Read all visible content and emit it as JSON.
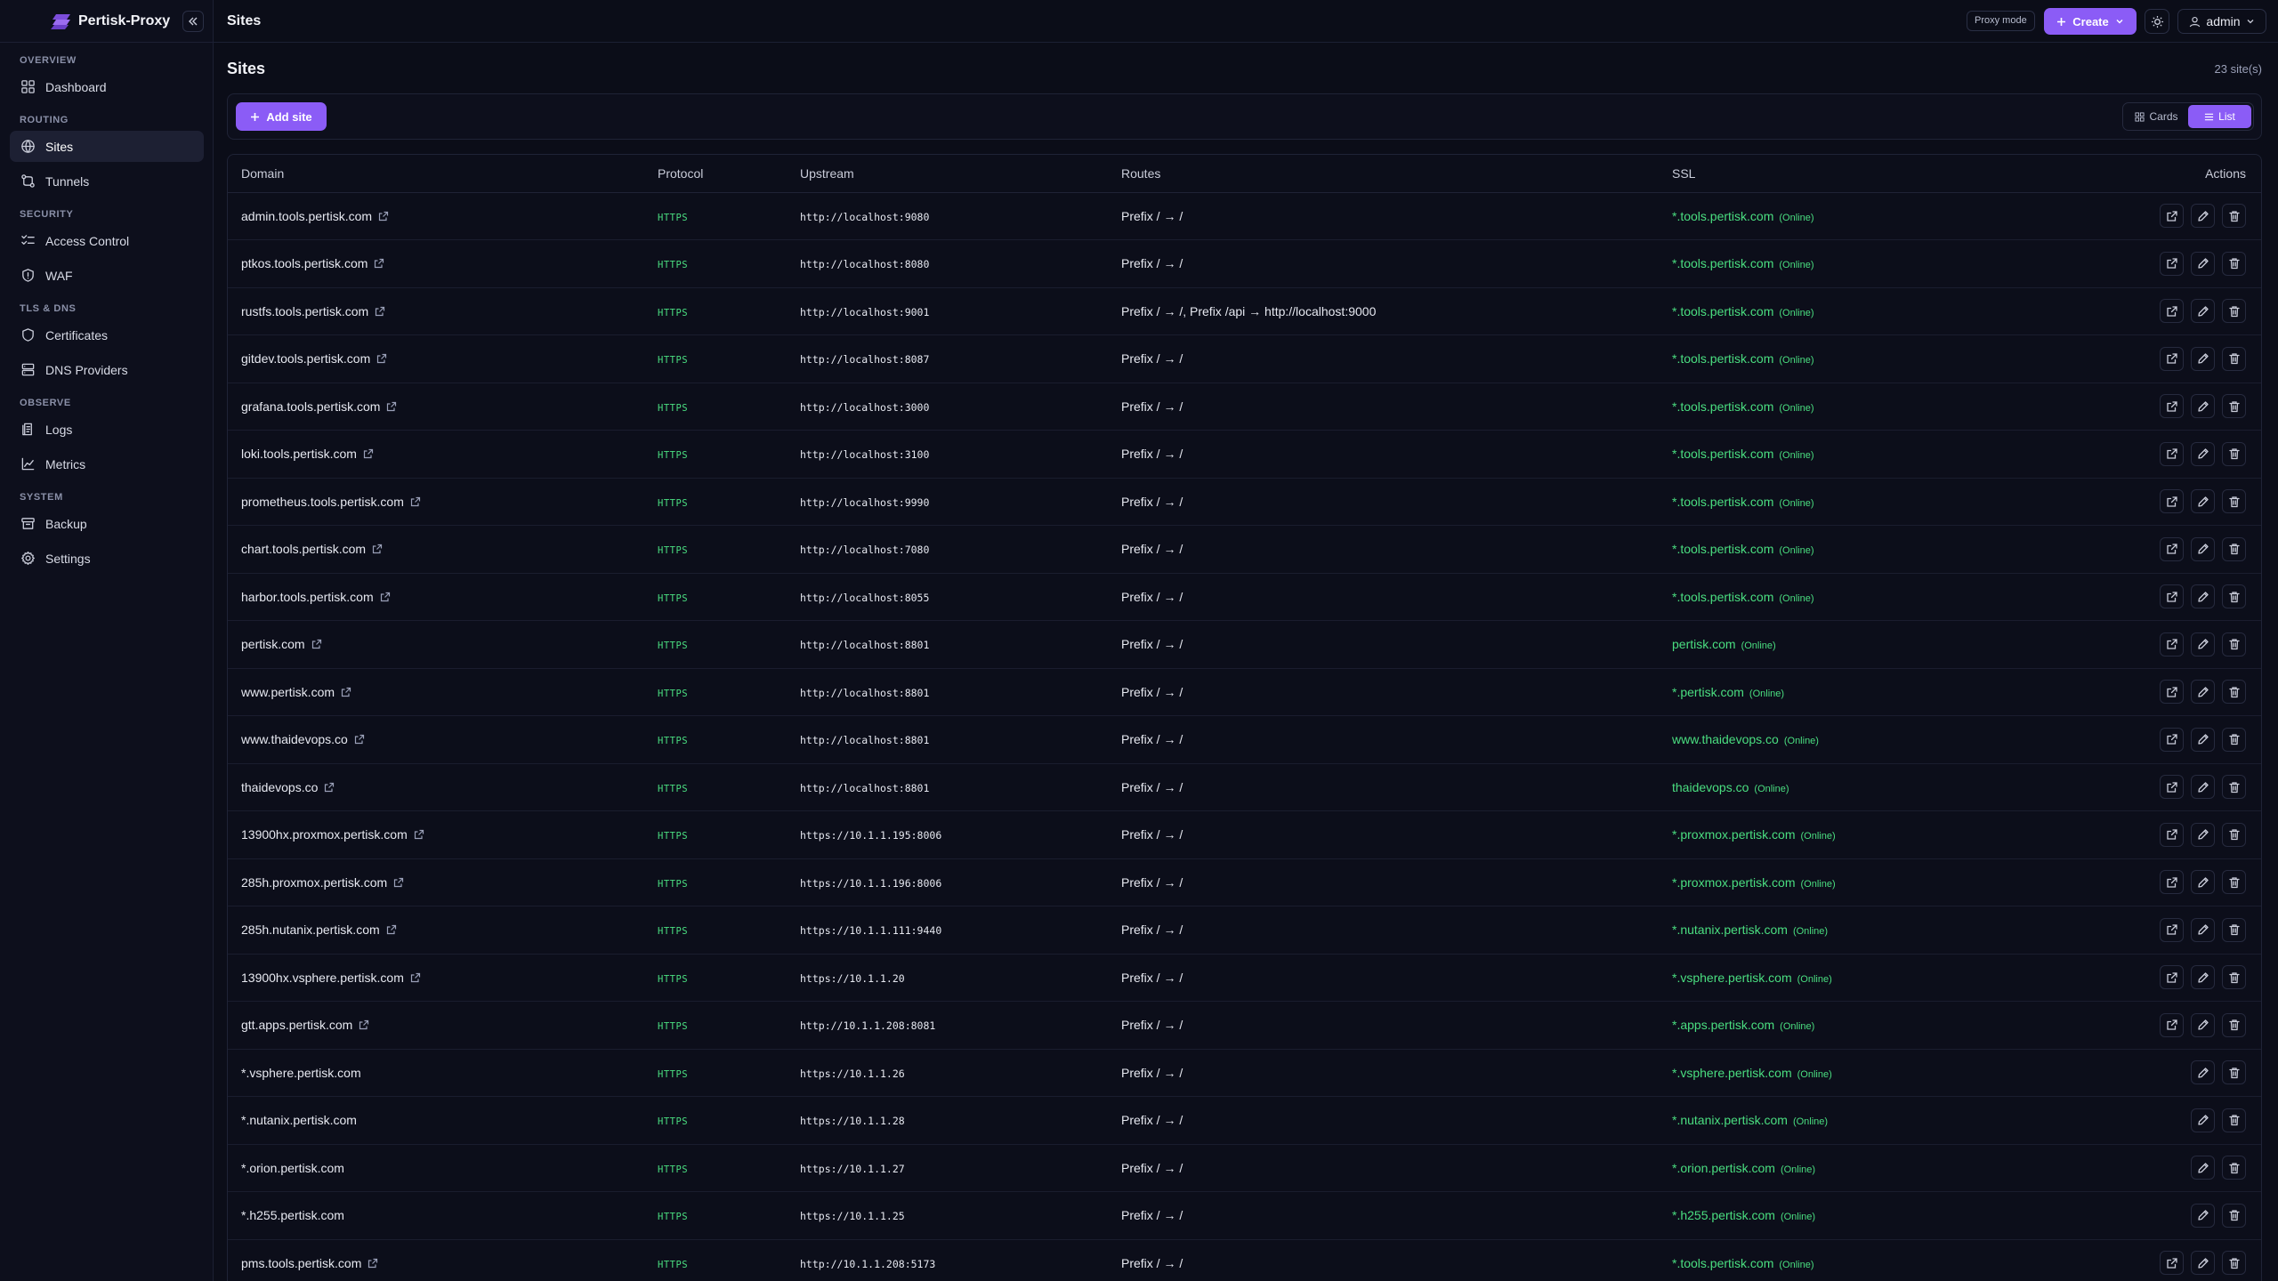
{
  "app": {
    "name": "Pertisk-Proxy",
    "mode_badge": "Proxy mode",
    "create_label": "Create",
    "user_label": "admin"
  },
  "colors": {
    "accent": "#8b5cf6",
    "success": "#4ade80",
    "background": "#0b0d18"
  },
  "nav": {
    "sections": [
      {
        "label": "OVERVIEW",
        "items": [
          {
            "label": "Dashboard",
            "icon": "dashboard-icon"
          }
        ]
      },
      {
        "label": "ROUTING",
        "items": [
          {
            "label": "Sites",
            "icon": "globe-icon",
            "active": true
          },
          {
            "label": "Tunnels",
            "icon": "tunnel-icon"
          }
        ]
      },
      {
        "label": "SECURITY",
        "items": [
          {
            "label": "Access Control",
            "icon": "access-control-icon"
          },
          {
            "label": "WAF",
            "icon": "shield-icon"
          }
        ]
      },
      {
        "label": "TLS & DNS",
        "items": [
          {
            "label": "Certificates",
            "icon": "certificate-icon"
          },
          {
            "label": "DNS Providers",
            "icon": "server-icon"
          }
        ]
      },
      {
        "label": "OBSERVE",
        "items": [
          {
            "label": "Logs",
            "icon": "logs-icon"
          },
          {
            "label": "Metrics",
            "icon": "chart-icon"
          }
        ]
      },
      {
        "label": "SYSTEM",
        "items": [
          {
            "label": "Backup",
            "icon": "archive-icon"
          },
          {
            "label": "Settings",
            "icon": "gear-icon"
          }
        ]
      }
    ]
  },
  "header": {
    "title": "Sites"
  },
  "main": {
    "title": "Sites",
    "count": "23 site(s)",
    "add_label": "Add site",
    "view_cards": "Cards",
    "view_list": "List",
    "columns": [
      "Domain",
      "Protocol",
      "Upstream",
      "Routes",
      "SSL",
      "Actions"
    ],
    "rows": [
      {
        "domain": "admin.tools.pertisk.com",
        "external": true,
        "protocol": "HTTPS",
        "upstream": "http://localhost:9080",
        "routes": "Prefix / → /",
        "ssl": "*.tools.pertisk.com",
        "status": "(Online)"
      },
      {
        "domain": "ptkos.tools.pertisk.com",
        "external": true,
        "protocol": "HTTPS",
        "upstream": "http://localhost:8080",
        "routes": "Prefix / → /",
        "ssl": "*.tools.pertisk.com",
        "status": "(Online)"
      },
      {
        "domain": "rustfs.tools.pertisk.com",
        "external": true,
        "protocol": "HTTPS",
        "upstream": "http://localhost:9001",
        "routes": "Prefix / → /, Prefix /api → http://localhost:9000",
        "ssl": "*.tools.pertisk.com",
        "status": "(Online)"
      },
      {
        "domain": "gitdev.tools.pertisk.com",
        "external": true,
        "protocol": "HTTPS",
        "upstream": "http://localhost:8087",
        "routes": "Prefix / → /",
        "ssl": "*.tools.pertisk.com",
        "status": "(Online)"
      },
      {
        "domain": "grafana.tools.pertisk.com",
        "external": true,
        "protocol": "HTTPS",
        "upstream": "http://localhost:3000",
        "routes": "Prefix / → /",
        "ssl": "*.tools.pertisk.com",
        "status": "(Online)"
      },
      {
        "domain": "loki.tools.pertisk.com",
        "external": true,
        "protocol": "HTTPS",
        "upstream": "http://localhost:3100",
        "routes": "Prefix / → /",
        "ssl": "*.tools.pertisk.com",
        "status": "(Online)"
      },
      {
        "domain": "prometheus.tools.pertisk.com",
        "external": true,
        "protocol": "HTTPS",
        "upstream": "http://localhost:9990",
        "routes": "Prefix / → /",
        "ssl": "*.tools.pertisk.com",
        "status": "(Online)"
      },
      {
        "domain": "chart.tools.pertisk.com",
        "external": true,
        "protocol": "HTTPS",
        "upstream": "http://localhost:7080",
        "routes": "Prefix / → /",
        "ssl": "*.tools.pertisk.com",
        "status": "(Online)"
      },
      {
        "domain": "harbor.tools.pertisk.com",
        "external": true,
        "protocol": "HTTPS",
        "upstream": "http://localhost:8055",
        "routes": "Prefix / → /",
        "ssl": "*.tools.pertisk.com",
        "status": "(Online)"
      },
      {
        "domain": "pertisk.com",
        "external": true,
        "protocol": "HTTPS",
        "upstream": "http://localhost:8801",
        "routes": "Prefix / → /",
        "ssl": "pertisk.com",
        "status": "(Online)"
      },
      {
        "domain": "www.pertisk.com",
        "external": true,
        "protocol": "HTTPS",
        "upstream": "http://localhost:8801",
        "routes": "Prefix / → /",
        "ssl": "*.pertisk.com",
        "status": "(Online)"
      },
      {
        "domain": "www.thaidevops.co",
        "external": true,
        "protocol": "HTTPS",
        "upstream": "http://localhost:8801",
        "routes": "Prefix / → /",
        "ssl": "www.thaidevops.co",
        "status": "(Online)"
      },
      {
        "domain": "thaidevops.co",
        "external": true,
        "protocol": "HTTPS",
        "upstream": "http://localhost:8801",
        "routes": "Prefix / → /",
        "ssl": "thaidevops.co",
        "status": "(Online)"
      },
      {
        "domain": "13900hx.proxmox.pertisk.com",
        "external": true,
        "protocol": "HTTPS",
        "upstream": "https://10.1.1.195:8006",
        "routes": "Prefix / → /",
        "ssl": "*.proxmox.pertisk.com",
        "status": "(Online)"
      },
      {
        "domain": "285h.proxmox.pertisk.com",
        "external": true,
        "protocol": "HTTPS",
        "upstream": "https://10.1.1.196:8006",
        "routes": "Prefix / → /",
        "ssl": "*.proxmox.pertisk.com",
        "status": "(Online)"
      },
      {
        "domain": "285h.nutanix.pertisk.com",
        "external": true,
        "protocol": "HTTPS",
        "upstream": "https://10.1.1.111:9440",
        "routes": "Prefix / → /",
        "ssl": "*.nutanix.pertisk.com",
        "status": "(Online)"
      },
      {
        "domain": "13900hx.vsphere.pertisk.com",
        "external": true,
        "protocol": "HTTPS",
        "upstream": "https://10.1.1.20",
        "routes": "Prefix / → /",
        "ssl": "*.vsphere.pertisk.com",
        "status": "(Online)"
      },
      {
        "domain": "gtt.apps.pertisk.com",
        "external": true,
        "protocol": "HTTPS",
        "upstream": "http://10.1.1.208:8081",
        "routes": "Prefix / → /",
        "ssl": "*.apps.pertisk.com",
        "status": "(Online)"
      },
      {
        "domain": "*.vsphere.pertisk.com",
        "external": false,
        "protocol": "HTTPS",
        "upstream": "https://10.1.1.26",
        "routes": "Prefix / → /",
        "ssl": "*.vsphere.pertisk.com",
        "status": "(Online)"
      },
      {
        "domain": "*.nutanix.pertisk.com",
        "external": false,
        "protocol": "HTTPS",
        "upstream": "https://10.1.1.28",
        "routes": "Prefix / → /",
        "ssl": "*.nutanix.pertisk.com",
        "status": "(Online)"
      },
      {
        "domain": "*.orion.pertisk.com",
        "external": false,
        "protocol": "HTTPS",
        "upstream": "https://10.1.1.27",
        "routes": "Prefix / → /",
        "ssl": "*.orion.pertisk.com",
        "status": "(Online)"
      },
      {
        "domain": "*.h255.pertisk.com",
        "external": false,
        "protocol": "HTTPS",
        "upstream": "https://10.1.1.25",
        "routes": "Prefix / → /",
        "ssl": "*.h255.pertisk.com",
        "status": "(Online)"
      },
      {
        "domain": "pms.tools.pertisk.com",
        "external": true,
        "protocol": "HTTPS",
        "upstream": "http://10.1.1.208:5173",
        "routes": "Prefix / → /",
        "ssl": "*.tools.pertisk.com",
        "status": "(Online)"
      }
    ]
  }
}
